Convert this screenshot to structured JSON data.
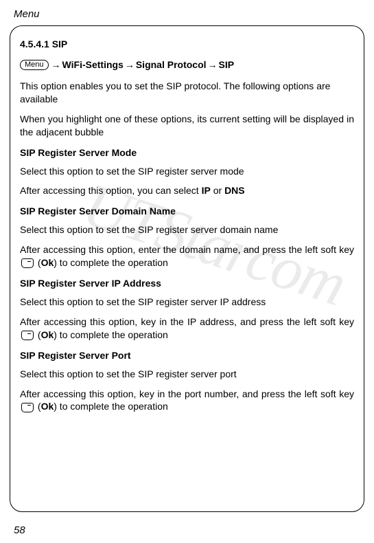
{
  "header": "Menu",
  "section_number": "4.5.4.1 SIP",
  "breadcrumb": {
    "menu_label": "Menu",
    "item1": "WiFi-Settings",
    "item2": "Signal Protocol",
    "item3": "SIP"
  },
  "intro": {
    "p1": "This option enables you to set the SIP protocol. The following options are available",
    "p2": "When you highlight one of these options, its current setting will be displayed in the adjacent bubble"
  },
  "sections": {
    "mode": {
      "title": "SIP Register Server Mode",
      "p1": "Select this option to set the SIP register server mode",
      "p2_pre": "After accessing this option, you can select ",
      "p2_bold1": "IP",
      "p2_mid": " or ",
      "p2_bold2": "DNS"
    },
    "domain": {
      "title": "SIP Register Server Domain Name",
      "p1": "Select this option to set the SIP register server domain name",
      "p2_pre": "After accessing this option, enter the domain name, and press the left soft key ",
      "p2_open": " (",
      "p2_bold": "Ok",
      "p2_close": ") to complete the operation"
    },
    "ip": {
      "title": "SIP Register Server IP Address",
      "p1": "Select this option to set the SIP register server IP address",
      "p2_pre": "After accessing this option, key in the IP address, and press the left soft key ",
      "p2_open": " (",
      "p2_bold": "Ok",
      "p2_close": ") to complete the operation"
    },
    "port": {
      "title": "SIP Register Server Port",
      "p1": "Select this option to set the SIP register server port",
      "p2_pre": "After accessing this option, key in the port number, and press the left soft key ",
      "p2_open": " (",
      "p2_bold": "Ok",
      "p2_close": ") to complete the operation"
    }
  },
  "page_number": "58",
  "watermark": "UTStarcom"
}
